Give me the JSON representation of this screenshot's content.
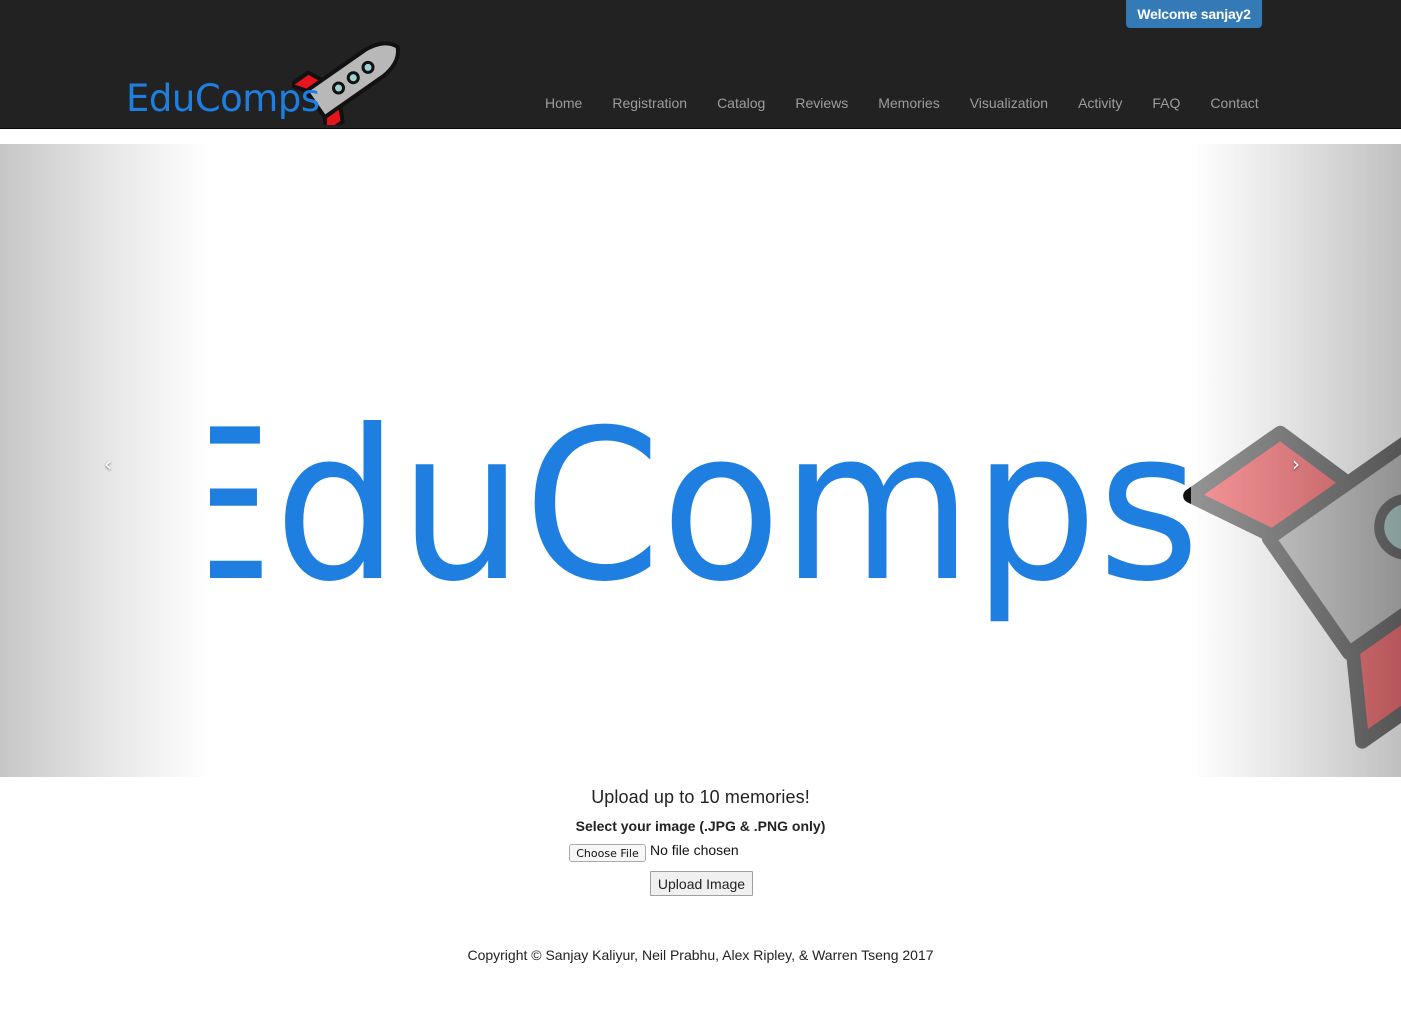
{
  "header": {
    "welcome_label": "Welcome sanjay2",
    "brand_name": "EduComps",
    "nav": [
      "Home",
      "Registration",
      "Catalog",
      "Reviews",
      "Memories",
      "Visualization",
      "Activity",
      "FAQ",
      "Contact"
    ]
  },
  "carousel": {
    "slide_logo_text": "EduComps",
    "prev_icon": "chevron-left-icon",
    "next_icon": "chevron-right-icon",
    "prev_glyph": "‹",
    "next_glyph": "›"
  },
  "upload": {
    "heading": "Upload up to 10 memories!",
    "select_label": "Select your image (.JPG & .PNG only)",
    "choose_file_label": "Choose File",
    "no_file_text": "No file chosen",
    "upload_button_label": "Upload Image"
  },
  "footer": {
    "copyright": "Copyright © Sanjay Kaliyur, Neil Prabhu, Alex Ripley, & Warren Tseng 2017"
  },
  "colors": {
    "navbar_bg": "#222222",
    "nav_link": "#9d9d9d",
    "welcome_button": "#337ab7",
    "brand_blue": "#1e7fe0",
    "rocket_red": "#e8141c",
    "rocket_gray": "#a8a8a8"
  }
}
